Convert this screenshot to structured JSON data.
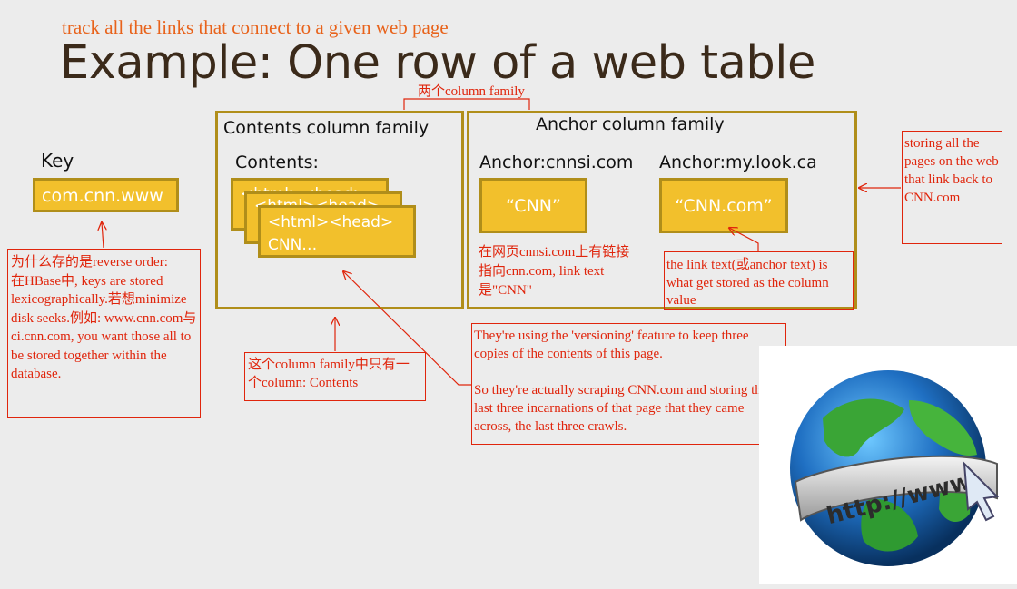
{
  "header": {
    "subtitle": "track all the links that connect to a given web page",
    "title": "Example: One row of a web table"
  },
  "top_note": "两个column family",
  "key": {
    "label": "Key",
    "value": "com.cnn.www"
  },
  "contents_family": {
    "title": "Contents column family",
    "column_label": "Contents:",
    "back_cell_1": "<html><head>",
    "back_cell_2": "<html><head>",
    "front_cell_line1": "<html><head>",
    "front_cell_line2": "CNN…"
  },
  "anchor_family": {
    "title": "Anchor column family",
    "col1_label": "Anchor:cnnsi.com",
    "col1_value": "“CNN”",
    "col2_label": "Anchor:my.look.ca",
    "col2_value": "“CNN.com”"
  },
  "notes": {
    "left": "为什么存的是reverse order:\n在HBase中, keys are stored lexicographically.若想minimize disk seeks.例如: www.cnn.com与ci.cnn.com, you want those all to be stored together within the database.",
    "contents_only": "这个column family中只有一个column: Contents",
    "cnnsi_text": "在网页cnnsi.com上有链接\n指向cnn.com, link text\n是\"CNN\"",
    "anchor_text": "the link text(或anchor text) is what get stored as the column value",
    "right": "storing all the pages on the web that link back to CNN.com",
    "versioning": "They're using the 'versioning' feature to keep three copies of the contents of this page.\n\nSo they're actually scraping CNN.com and storing the last three incarnations of that page that they came across, the last three crawls."
  },
  "globe": {
    "text": "http://www."
  }
}
